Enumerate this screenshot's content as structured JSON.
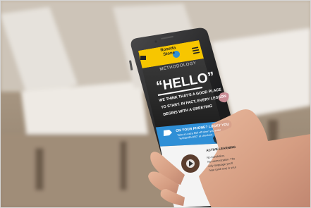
{
  "app": {
    "brand_line1": "Rosetta",
    "brand_line2": "Stone",
    "nav_label": "METHODOLOGY",
    "hero_title": "“HELLO”",
    "hero_line1": "WE THINK THAT'S A GOOD PLACE",
    "hero_line2": "TO START. IN FACT, EVERY LESSON",
    "hero_line3": "BEGINS WITH A GREETING",
    "promo_title": "ON YOUR PHONE? LUCKY YOU",
    "promo_line1": "Take an extra $50 off when you enter",
    "promo_line2": "\"HANDHELD50\" at checkout",
    "section_title": "ACTIVE LEARNING",
    "section_line1": "No translation.",
    "section_line2": "No memorization. The",
    "section_line3": "only language you'll",
    "section_line4": "hear (and see) is your"
  },
  "colors": {
    "brand_yellow": "#f7c600",
    "promo_blue": "#2f8fd6",
    "hero_dark": "#2b2b2b"
  }
}
